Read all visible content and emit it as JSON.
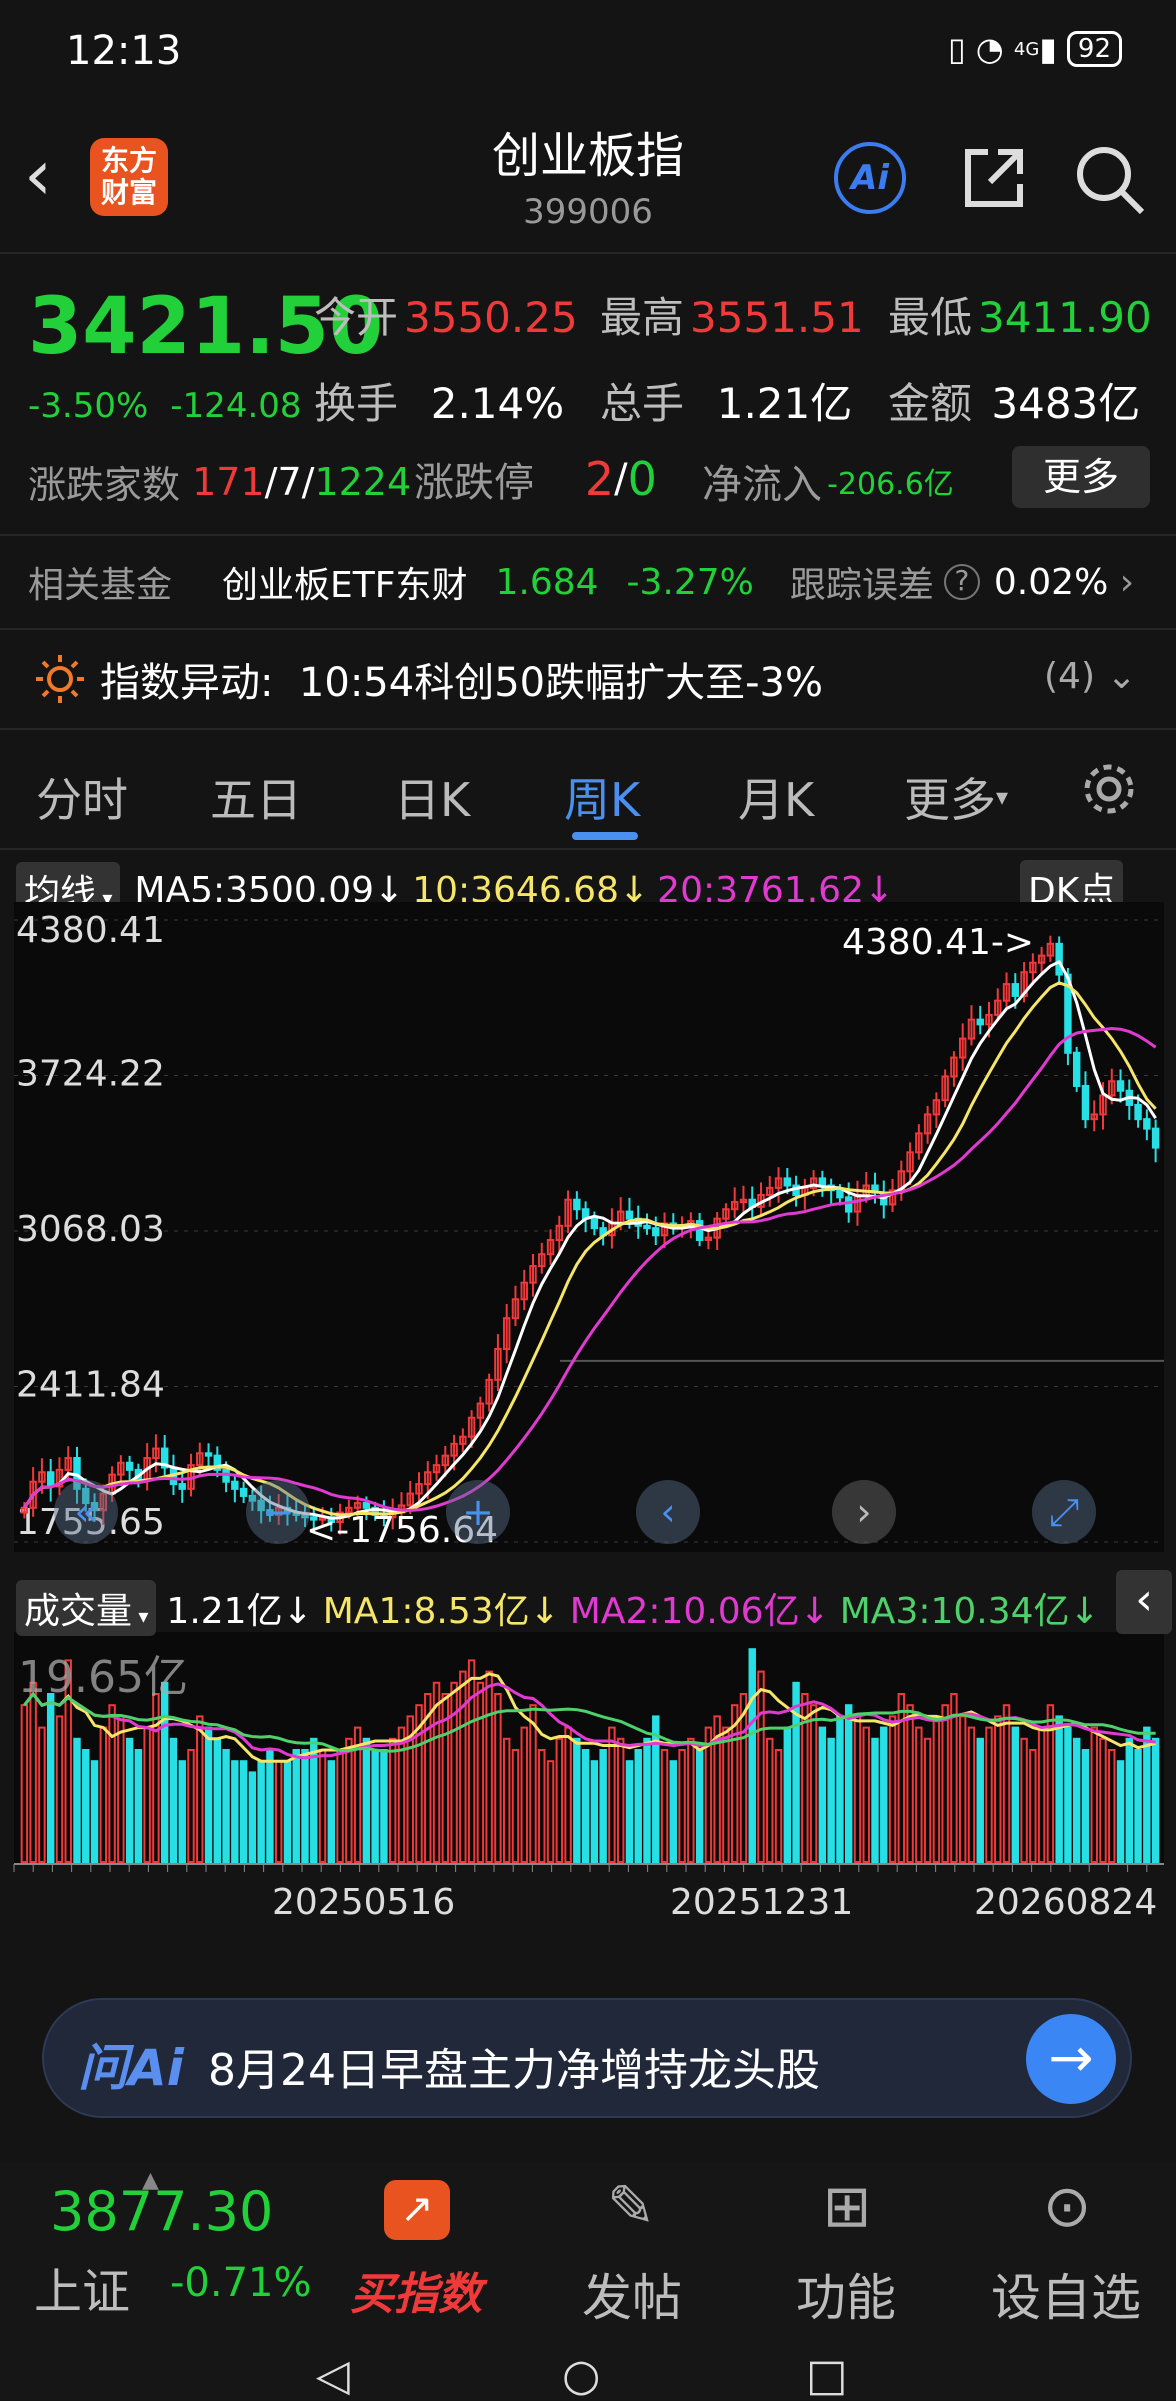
{
  "status": {
    "time": "12:13",
    "battery": "92",
    "signal": "4G"
  },
  "header": {
    "title": "创业板指",
    "code": "399006",
    "ai_label": "Ai"
  },
  "quote": {
    "price": "3421.50",
    "change_pct": "-3.50%",
    "change_abs": "-124.08",
    "open_label": "今开",
    "open": "3550.25",
    "high_label": "最高",
    "high": "3551.51",
    "low_label": "最低",
    "low": "3411.90",
    "turnover_label": "换手",
    "turnover": "2.14%",
    "volume_label": "总手",
    "volume": "1.21亿",
    "amount_label": "金额",
    "amount": "3483亿",
    "breadth_label": "涨跌家数",
    "breadth_up": "171",
    "breadth_flat": "7",
    "breadth_down": "1224",
    "slash": "/",
    "limit_label": "涨跌停",
    "limit_up": "2",
    "limit_down": "0",
    "netflow_label": "净流入",
    "netflow": "-206.6亿",
    "more_label": "更多"
  },
  "fund": {
    "label": "相关基金",
    "name": "创业板ETF东财",
    "price": "1.684",
    "pct": "-3.27%",
    "err_label": "跟踪误差",
    "err_value": "0.02%"
  },
  "alert": {
    "label": "指数异动:",
    "text": "10:54科创50跌幅扩大至-3%",
    "count": "(4)"
  },
  "tabs": [
    "分时",
    "五日",
    "日K",
    "周K",
    "月K",
    "更多"
  ],
  "active_tab": 3,
  "ma": {
    "type_label": "均线",
    "ma5": "MA5:3500.09↓",
    "ma10": "10:3646.68↓",
    "ma20": "20:3761.62↓",
    "dk_label": "DK点"
  },
  "vol": {
    "type_label": "成交量",
    "value": "1.21亿↓",
    "ma1": "MA1:8.53亿↓",
    "ma2": "MA2:10.06亿↓",
    "ma3": "MA3:10.34亿↓",
    "max_label": "19.65亿"
  },
  "chart_data": {
    "type": "candlestick",
    "y_ticks": [
      "4380.41",
      "3724.22",
      "3068.03",
      "2411.84",
      "1755.65"
    ],
    "ylim": [
      1755.65,
      4380.41
    ],
    "max_annotation": "4380.41->",
    "min_annotation": "<-1756.64",
    "x_labels": [
      "20250516",
      "20251231",
      "20260824"
    ],
    "closes": [
      1900,
      2010,
      2050,
      1990,
      2060,
      2110,
      1980,
      1920,
      1890,
      1960,
      2040,
      2090,
      2060,
      2020,
      2110,
      2150,
      2070,
      2000,
      1980,
      2080,
      2130,
      2120,
      2060,
      2010,
      1980,
      1950,
      1930,
      1890,
      1870,
      1900,
      1880,
      1870,
      1860,
      1850,
      1860,
      1840,
      1880,
      1900,
      1920,
      1900,
      1870,
      1860,
      1880,
      1910,
      1960,
      2000,
      2050,
      2080,
      2120,
      2170,
      2200,
      2280,
      2340,
      2440,
      2570,
      2700,
      2780,
      2850,
      2920,
      2970,
      3030,
      3090,
      3200,
      3160,
      3120,
      3080,
      3050,
      3100,
      3150,
      3120,
      3090,
      3080,
      3050,
      3100,
      3080,
      3090,
      3110,
      3030,
      3040,
      3120,
      3160,
      3190,
      3200,
      3170,
      3220,
      3250,
      3290,
      3260,
      3220,
      3250,
      3290,
      3260,
      3240,
      3210,
      3150,
      3220,
      3260,
      3230,
      3180,
      3240,
      3320,
      3400,
      3480,
      3560,
      3620,
      3720,
      3800,
      3880,
      3960,
      3940,
      3980,
      4040,
      4110,
      4060,
      4160,
      4200,
      4230,
      4280,
      4150,
      3820,
      3680,
      3540,
      3560,
      3640,
      3700,
      3660,
      3600,
      3540,
      3500,
      3420
    ],
    "volumes": [
      14,
      16,
      12,
      15,
      13,
      18,
      11,
      10,
      9,
      12,
      14,
      13,
      11,
      10,
      12,
      15,
      16,
      11,
      9,
      10,
      13,
      12,
      11,
      10,
      9,
      9,
      8,
      9,
      10,
      9,
      9,
      10,
      10,
      11,
      10,
      9,
      10,
      11,
      12,
      11,
      10,
      10,
      11,
      12,
      13,
      14,
      15,
      16,
      15,
      16,
      17,
      18,
      16,
      17,
      15,
      11,
      10,
      12,
      14,
      10,
      9,
      11,
      12,
      11,
      10,
      9,
      10,
      12,
      11,
      9,
      10,
      11,
      13,
      10,
      9,
      10,
      11,
      10,
      12,
      13,
      12,
      14,
      15,
      19,
      17,
      11,
      10,
      12,
      16,
      15,
      14,
      12,
      11,
      13,
      14,
      13,
      12,
      11,
      12,
      13,
      15,
      14,
      12,
      11,
      13,
      14,
      15,
      13,
      12,
      11,
      12,
      13,
      14,
      12,
      11,
      10,
      12,
      14,
      13,
      12,
      11,
      10,
      12,
      11,
      10,
      9,
      11,
      10,
      12,
      11
    ],
    "ma5": [
      3500.09
    ],
    "ma10": [
      3646.68
    ],
    "ma20": [
      3761.62
    ]
  },
  "ask_ai": {
    "logo": "问Ai",
    "text": "8月24日早盘主力净增持龙头股"
  },
  "bottom": {
    "sh_price": "3877.30",
    "sh_label": "上证",
    "sh_pct": "-0.71%",
    "buy_label": "买指数",
    "post_label": "发帖",
    "func_label": "功能",
    "watch_label": "设自选"
  }
}
